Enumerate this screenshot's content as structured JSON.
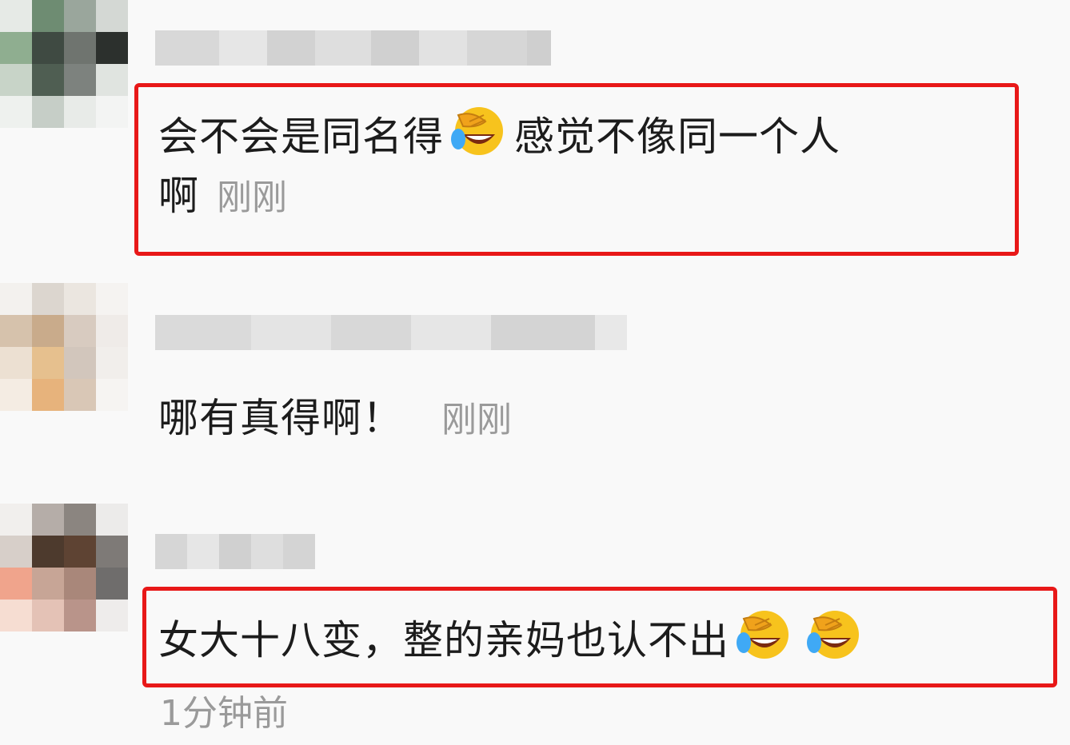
{
  "comments": [
    {
      "text_line1": "会不会是同名得",
      "text_line1_after_emoji": "感觉不像同一个人",
      "text_line2": "啊",
      "time": "刚刚",
      "emoji": "facepalm-laugh-cry-emoji",
      "highlighted": true,
      "avatar_colors": [
        "#e6eae6",
        "#6e8c72",
        "#9aa69c",
        "#d4d8d4",
        "#8fae90",
        "#3f4a42",
        "#6f746f",
        "#2c302d",
        "#c8d4c8",
        "#4f5e52",
        "#7d827e",
        "#e0e4e0",
        "#eef1ee",
        "#c6cec7",
        "#e8ebe8",
        "#f3f4f3"
      ]
    },
    {
      "text": "哪有真得啊！",
      "time": "刚刚",
      "highlighted": false,
      "avatar_colors": [
        "#f3f1ee",
        "#dcd6cf",
        "#ebe6e0",
        "#f5f3f1",
        "#d6c2ac",
        "#c9ab8b",
        "#d8cbc0",
        "#efebe8",
        "#ece0d2",
        "#e6c08e",
        "#d2c6bc",
        "#f1eeeb",
        "#f4ece3",
        "#e7b37c",
        "#d9c7b6",
        "#f6f4f2"
      ]
    },
    {
      "text": "女大十八变，整的亲妈也认不出",
      "time": "1分钟前",
      "emoji": "facepalm-laugh-cry-emoji",
      "emoji_count": 2,
      "highlighted": true,
      "avatar_colors": [
        "#f1efed",
        "#b5ada8",
        "#8b8580",
        "#ecebea",
        "#d7cfc9",
        "#4d3a2d",
        "#5e4333",
        "#7e7a77",
        "#f0a48c",
        "#c7a596",
        "#a9877a",
        "#6f6d6c",
        "#f6ddd2",
        "#e4c2b6",
        "#b9948a",
        "#eeeceb"
      ]
    }
  ],
  "colors": {
    "highlight_border": "#e81818",
    "timestamp": "#9a9a9a",
    "text": "#1c1c1c",
    "background": "#f9f9f9"
  }
}
